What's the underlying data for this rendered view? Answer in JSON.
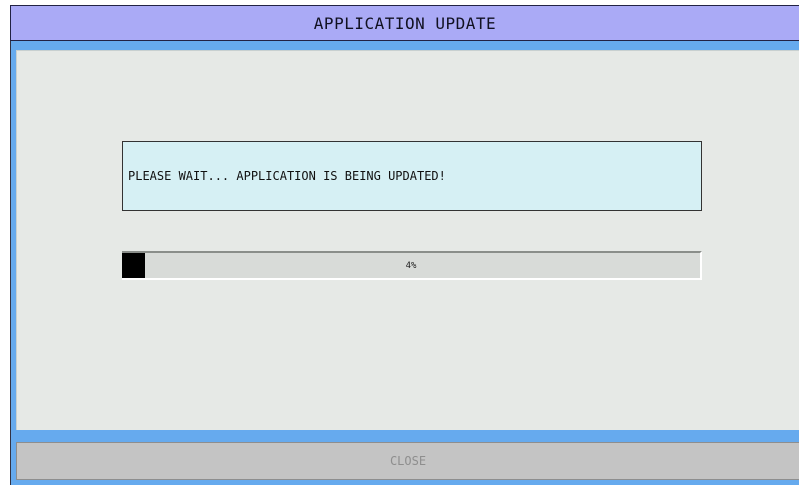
{
  "window": {
    "title": "APPLICATION UPDATE"
  },
  "message": {
    "text": "PLEASE WAIT... APPLICATION IS BEING UPDATED!"
  },
  "progress": {
    "value": 4,
    "label": "4%"
  },
  "footer": {
    "close_label": "CLOSE",
    "close_enabled": false
  },
  "colors": {
    "titlebar": "#aaaaf6",
    "frame": "#66aaee",
    "content": "#e6e9e6",
    "message_bg": "#d6f0f4",
    "progress_fill": "#000000",
    "button": "#c4c4c4",
    "button_text_disabled": "#8e8e8e"
  }
}
